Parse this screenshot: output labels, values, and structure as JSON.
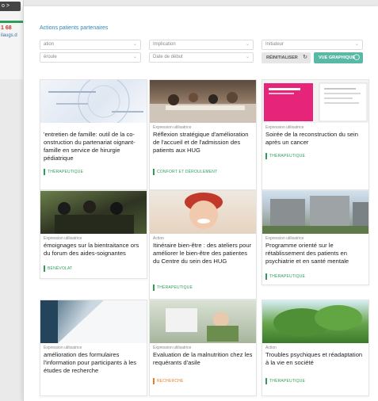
{
  "background_window": {
    "tab_label": "o >",
    "number": "1 68",
    "link_text": "ilaugs.d"
  },
  "page": {
    "title": "Actions patients partenaires"
  },
  "filters": {
    "row1": [
      {
        "label": "ation"
      },
      {
        "label": "Implication"
      },
      {
        "label": "Initiateur"
      }
    ],
    "row2": [
      {
        "label": "éroule"
      },
      {
        "label": "Date de début"
      }
    ],
    "reset_label": "RÉINITIALISER",
    "map_label": "VUE GRAPHIQUE"
  },
  "cards": [
    {
      "category": "",
      "title": "'entretien de famille: outil de la co-onstruction du partenariat oignant-famille en service de hirurgie pédiatrique",
      "tag": "THÉRAPEUTIQUE",
      "tag_color": "#2f9d5a"
    },
    {
      "category": "Expression utilisatrice",
      "title": "Réflexion stratégique d'amélioration de l'accueil et de l'admission des patients aux HUG",
      "tag": "CONFORT ET DÉROULEMENT",
      "tag_color": "#2f9d5a"
    },
    {
      "category": "Expression utilisatrice",
      "title": "Soirée de la reconstruction du sein après un cancer",
      "tag": "THÉRAPEUTIQUE",
      "tag_color": "#2f9d5a"
    },
    {
      "category": "Expression utilisatrice",
      "title": "émoignages sur la bientraitance ors du forum des aides-soignantes",
      "tag": "BÉNÉVOLAT",
      "tag_color": "#2f9d5a"
    },
    {
      "category": "Action",
      "title": "Itinéraire bien-être : des ateliers pour améliorer le bien-être des patientes du Centre du sein des HUG",
      "tag": "THÉRAPEUTIQUE",
      "tag_color": "#2f9d5a"
    },
    {
      "category": "Expression utilisatrice",
      "title": "Programme orienté sur le rétablissement des patients en psychiatrie et en santé mentale",
      "tag": "THÉRAPEUTIQUE",
      "tag_color": "#2f9d5a"
    },
    {
      "category": "Expression utilisatrice",
      "title": "amélioration des formulaires l'information pour participants à les études de recherche",
      "tag": "",
      "tag_color": "#2f9d5a"
    },
    {
      "category": "Expression utilisatrice",
      "title": "Evaluation de la malnutrition chez les requérants d'asile",
      "tag": "RECHERCHE",
      "tag_color": "#e67e22"
    },
    {
      "category": "Action",
      "title": "Troubles psychiques et réadaptation à la vie en société",
      "tag": "THÉRAPEUTIQUE",
      "tag_color": "#2f9d5a"
    }
  ]
}
